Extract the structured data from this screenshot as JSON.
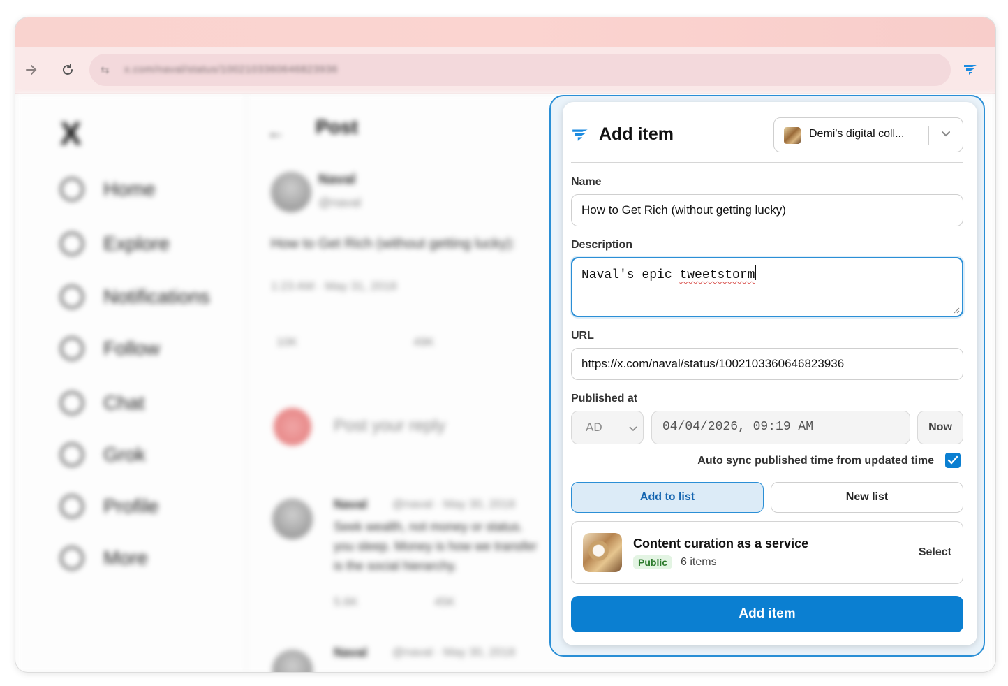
{
  "browser": {
    "url": "x.com/naval/status/1002103360646823936"
  },
  "background_page": {
    "nav_items": [
      "Home",
      "Explore",
      "Notifications",
      "Follow",
      "Chat",
      "Grok",
      "Profile",
      "More"
    ],
    "post_header": "Post",
    "author_name": "Naval",
    "author_handle": "@naval",
    "post_text": "How to Get Rich (without getting lucky):",
    "post_time": "1:23 AM · May 31, 2018",
    "stats": [
      "10K",
      "49K"
    ],
    "reply_placeholder": "Post your reply",
    "reply1_meta": "@naval · May 30, 2018",
    "reply1_lines": [
      "Seek wealth, not money or status.",
      "you sleep. Money is how we transfer",
      "is the social hierarchy."
    ],
    "reply1_stats": [
      "5.6K",
      "45K"
    ],
    "reply2_meta": "@naval · May 30, 2018"
  },
  "popup": {
    "title": "Add item",
    "collection": "Demi's digital coll...",
    "name_label": "Name",
    "name_value": "How to Get Rich (without getting lucky)",
    "description_label": "Description",
    "description_prefix": "Naval's epic ",
    "description_word": "tweetstorm",
    "url_label": "URL",
    "url_value": "https://x.com/naval/status/1002103360646823936",
    "published_label": "Published at",
    "era_value": "AD",
    "datetime_value": "04/04/2026, 09:19 AM",
    "now_label": "Now",
    "autosync_label": "Auto sync published time from updated time",
    "autosync_checked": true,
    "add_to_list_label": "Add to list",
    "new_list_label": "New list",
    "list": {
      "name": "Content curation as a service",
      "visibility": "Public",
      "count": "6 items",
      "select_label": "Select"
    },
    "submit_label": "Add item",
    "accent_color": "#0b7fd1"
  }
}
